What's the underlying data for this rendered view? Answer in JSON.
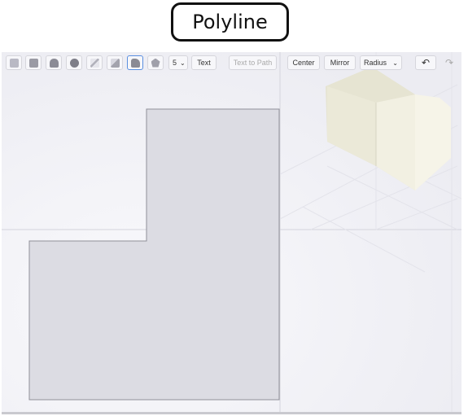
{
  "caption": {
    "title": "Polyline"
  },
  "toolbar": {
    "tools": [
      {
        "name": "select-tool-icon",
        "color": "#b9b9c4"
      },
      {
        "name": "box-tool-icon",
        "color": "#9a9aa4"
      },
      {
        "name": "cylinder-tool-icon",
        "color": "#8c8c96"
      },
      {
        "name": "sphere-tool-icon",
        "color": "#7e7e88"
      },
      {
        "name": "line-tool-icon",
        "color": "#b0b0ba"
      },
      {
        "name": "extrude-tool-icon",
        "color": "#a3a3ad"
      },
      {
        "name": "polyline-tool-icon",
        "color": "#8a8a94",
        "active": true
      },
      {
        "name": "polygon-tool-icon",
        "color": "#a0a0aa"
      }
    ],
    "sides_value": "5",
    "text_label": "Text",
    "text_to_path_label": "Text to Path",
    "center_label": "Center",
    "mirror_label": "Mirror",
    "radius_value": "Radius",
    "undo_glyph": "↶",
    "redo_glyph": "↷"
  },
  "colors": {
    "viewport_bg": "#f1f1f6",
    "shape_fill": "#dcdce3",
    "shape_stroke": "#8f8f99",
    "axis_line": "#d4d4dc",
    "box_front": "#f2f0e2",
    "box_side": "#e6e4d2",
    "accent": "#5a8fe0"
  }
}
